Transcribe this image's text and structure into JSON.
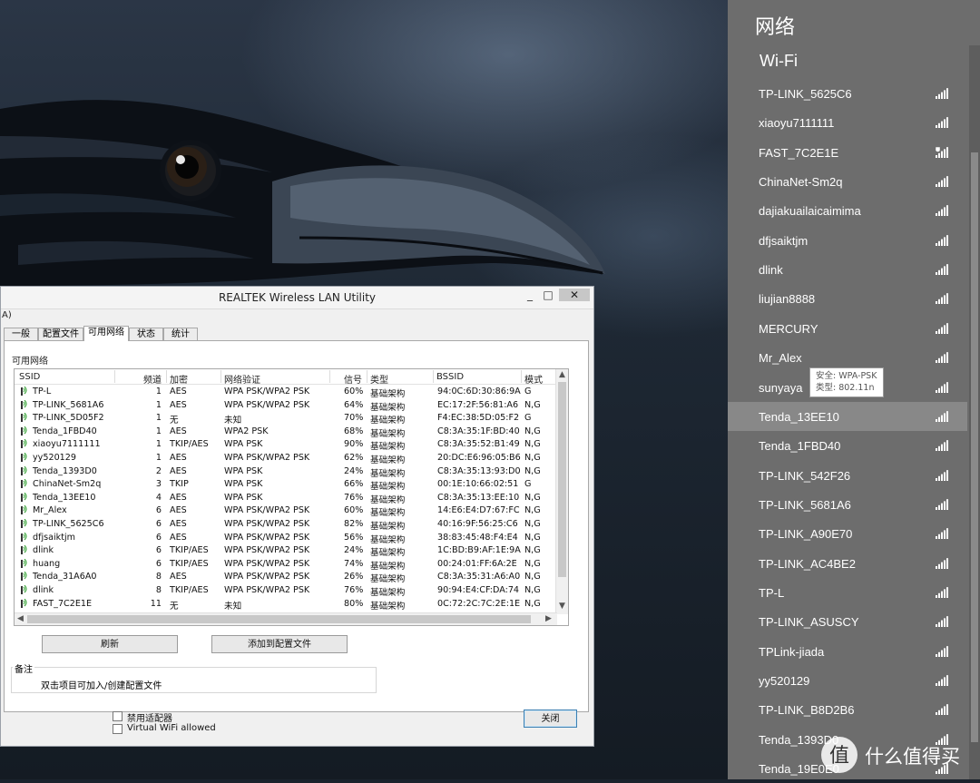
{
  "window": {
    "title": "REALTEK Wireless LAN Utility",
    "menu_fragment": "A)",
    "minimize_glyph": "_",
    "maximize_glyph": "□",
    "close_glyph": "✕",
    "tabs": [
      {
        "label": "一般",
        "active": false
      },
      {
        "label": "配置文件",
        "active": false
      },
      {
        "label": "可用网络",
        "active": true
      },
      {
        "label": "状态",
        "active": false
      },
      {
        "label": "统计",
        "active": false
      }
    ],
    "section_label": "可用网络",
    "columns": [
      "SSID",
      "频道",
      "加密",
      "网络验证",
      "信号",
      "类型",
      "BSSID",
      "模式"
    ],
    "rows": [
      {
        "ssid": "TP-L",
        "channel": "1",
        "enc": "AES",
        "auth": "WPA PSK/WPA2 PSK",
        "signal": "60%",
        "type": "基础架构",
        "bssid": "94:0C:6D:30:86:9A",
        "mode": "G"
      },
      {
        "ssid": "TP-LINK_5681A6",
        "channel": "1",
        "enc": "AES",
        "auth": "WPA PSK/WPA2 PSK",
        "signal": "64%",
        "type": "基础架构",
        "bssid": "EC:17:2F:56:81:A6",
        "mode": "N,G"
      },
      {
        "ssid": "TP-LINK_5D05F2",
        "channel": "1",
        "enc": "无",
        "auth": "未知",
        "signal": "70%",
        "type": "基础架构",
        "bssid": "F4:EC:38:5D:05:F2",
        "mode": "G"
      },
      {
        "ssid": "Tenda_1FBD40",
        "channel": "1",
        "enc": "AES",
        "auth": "WPA2 PSK",
        "signal": "68%",
        "type": "基础架构",
        "bssid": "C8:3A:35:1F:BD:40",
        "mode": "N,G"
      },
      {
        "ssid": "xiaoyu7111111",
        "channel": "1",
        "enc": "TKIP/AES",
        "auth": "WPA PSK",
        "signal": "90%",
        "type": "基础架构",
        "bssid": "C8:3A:35:52:B1:49",
        "mode": "N,G"
      },
      {
        "ssid": "yy520129",
        "channel": "1",
        "enc": "AES",
        "auth": "WPA PSK/WPA2 PSK",
        "signal": "62%",
        "type": "基础架构",
        "bssid": "20:DC:E6:96:05:B6",
        "mode": "N,G"
      },
      {
        "ssid": "Tenda_1393D0",
        "channel": "2",
        "enc": "AES",
        "auth": "WPA PSK",
        "signal": "24%",
        "type": "基础架构",
        "bssid": "C8:3A:35:13:93:D0",
        "mode": "N,G"
      },
      {
        "ssid": "ChinaNet-Sm2q",
        "channel": "3",
        "enc": "TKIP",
        "auth": "WPA PSK",
        "signal": "66%",
        "type": "基础架构",
        "bssid": "00:1E:10:66:02:51",
        "mode": "G"
      },
      {
        "ssid": "Tenda_13EE10",
        "channel": "4",
        "enc": "AES",
        "auth": "WPA PSK",
        "signal": "76%",
        "type": "基础架构",
        "bssid": "C8:3A:35:13:EE:10",
        "mode": "N,G"
      },
      {
        "ssid": "Mr_Alex",
        "channel": "6",
        "enc": "AES",
        "auth": "WPA PSK/WPA2 PSK",
        "signal": "60%",
        "type": "基础架构",
        "bssid": "14:E6:E4:D7:67:FC",
        "mode": "N,G"
      },
      {
        "ssid": "TP-LINK_5625C6",
        "channel": "6",
        "enc": "AES",
        "auth": "WPA PSK/WPA2 PSK",
        "signal": "82%",
        "type": "基础架构",
        "bssid": "40:16:9F:56:25:C6",
        "mode": "N,G"
      },
      {
        "ssid": "dfjsaiktjm",
        "channel": "6",
        "enc": "AES",
        "auth": "WPA PSK/WPA2 PSK",
        "signal": "56%",
        "type": "基础架构",
        "bssid": "38:83:45:48:F4:E4",
        "mode": "N,G"
      },
      {
        "ssid": "dlink",
        "channel": "6",
        "enc": "TKIP/AES",
        "auth": "WPA PSK/WPA2 PSK",
        "signal": "24%",
        "type": "基础架构",
        "bssid": "1C:BD:B9:AF:1E:9A",
        "mode": "N,G"
      },
      {
        "ssid": "huang",
        "channel": "6",
        "enc": "TKIP/AES",
        "auth": "WPA PSK/WPA2 PSK",
        "signal": "74%",
        "type": "基础架构",
        "bssid": "00:24:01:FF:6A:2E",
        "mode": "N,G"
      },
      {
        "ssid": "Tenda_31A6A0",
        "channel": "8",
        "enc": "AES",
        "auth": "WPA PSK/WPA2 PSK",
        "signal": "26%",
        "type": "基础架构",
        "bssid": "C8:3A:35:31:A6:A0",
        "mode": "N,G"
      },
      {
        "ssid": "dlink",
        "channel": "8",
        "enc": "TKIP/AES",
        "auth": "WPA PSK/WPA2 PSK",
        "signal": "76%",
        "type": "基础架构",
        "bssid": "90:94:E4:CF:DA:74",
        "mode": "N,G"
      },
      {
        "ssid": "FAST_7C2E1E",
        "channel": "11",
        "enc": "无",
        "auth": "未知",
        "signal": "80%",
        "type": "基础架构",
        "bssid": "0C:72:2C:7C:2E:1E",
        "mode": "N,G"
      }
    ],
    "refresh_label": "刷新",
    "add_profile_label": "添加到配置文件",
    "note_title": "备注",
    "note_text": "双击项目可加入/创建配置文件",
    "disable_adapter_label": "禁用适配器",
    "virtual_wifi_label": "Virtual WiFi allowed",
    "close_label": "关闭"
  },
  "network_panel": {
    "title": "网络",
    "wifi_label": "Wi-Fi",
    "networks": [
      {
        "name": "TP-LINK_5625C6",
        "secured": false,
        "selected": false
      },
      {
        "name": "xiaoyu7111111",
        "secured": false,
        "selected": false
      },
      {
        "name": "FAST_7C2E1E",
        "secured": true,
        "selected": false
      },
      {
        "name": "ChinaNet-Sm2q",
        "secured": false,
        "selected": false
      },
      {
        "name": "dajiakuailaicaimima",
        "secured": false,
        "selected": false
      },
      {
        "name": "dfjsaiktjm",
        "secured": false,
        "selected": false
      },
      {
        "name": "dlink",
        "secured": false,
        "selected": false
      },
      {
        "name": "liujian8888",
        "secured": false,
        "selected": false
      },
      {
        "name": "MERCURY",
        "secured": false,
        "selected": false
      },
      {
        "name": "Mr_Alex",
        "secured": false,
        "selected": false
      },
      {
        "name": "sunyaya",
        "secured": false,
        "selected": false
      },
      {
        "name": "Tenda_13EE10",
        "secured": false,
        "selected": true
      },
      {
        "name": "Tenda_1FBD40",
        "secured": false,
        "selected": false
      },
      {
        "name": "TP-LINK_542F26",
        "secured": false,
        "selected": false
      },
      {
        "name": "TP-LINK_5681A6",
        "secured": false,
        "selected": false
      },
      {
        "name": "TP-LINK_A90E70",
        "secured": false,
        "selected": false
      },
      {
        "name": "TP-LINK_AC4BE2",
        "secured": false,
        "selected": false
      },
      {
        "name": "TP-L",
        "secured": false,
        "selected": false
      },
      {
        "name": "TP-LINK_ASUSCY",
        "secured": false,
        "selected": false
      },
      {
        "name": "TPLink-jiada",
        "secured": false,
        "selected": false
      },
      {
        "name": "yy520129",
        "secured": false,
        "selected": false
      },
      {
        "name": "TP-LINK_B8D2B6",
        "secured": false,
        "selected": false
      },
      {
        "name": "Tenda_1393D0",
        "secured": false,
        "selected": false
      },
      {
        "name": "Tenda_19E0E0",
        "secured": false,
        "selected": false
      }
    ],
    "tooltip": {
      "line1": "安全: WPA-PSK",
      "line2": "类型: 802.11n"
    }
  },
  "watermark": {
    "text": "什么值得买",
    "icon": "zhi-logo-icon"
  },
  "colors": {
    "panel_bg": "#6d6d6d",
    "panel_selected": "#888888",
    "window_bg": "#f0f0f0",
    "signal_green": "#2a9d2a"
  }
}
